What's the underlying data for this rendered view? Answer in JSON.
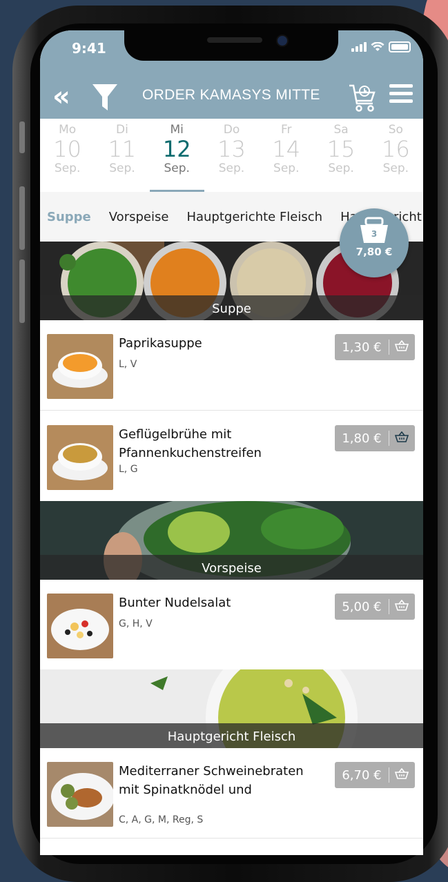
{
  "status": {
    "time": "9:41"
  },
  "header": {
    "title": "ORDER KAMASYS MITTE"
  },
  "days": [
    {
      "name": "Mo",
      "date": "10",
      "month": "Sep."
    },
    {
      "name": "Di",
      "date": "11",
      "month": "Sep."
    },
    {
      "name": "Mi",
      "date": "12",
      "month": "Sep."
    },
    {
      "name": "Do",
      "date": "13",
      "month": "Sep."
    },
    {
      "name": "Fr",
      "date": "14",
      "month": "Sep."
    },
    {
      "name": "Sa",
      "date": "15",
      "month": "Sep."
    },
    {
      "name": "So",
      "date": "16",
      "month": "Sep."
    }
  ],
  "categories": [
    "Suppe",
    "Vorspeise",
    "Hauptgerichte Fleisch",
    "Hauptgericht"
  ],
  "basket": {
    "count": "3",
    "total": "7,80 €"
  },
  "sections": [
    {
      "label": "Suppe"
    },
    {
      "label": "Vorspeise"
    },
    {
      "label": "Hauptgericht Fleisch"
    }
  ],
  "items": [
    {
      "name": "Paprikasuppe",
      "allergens": "L, V",
      "price": "1,30 €"
    },
    {
      "name": "Geflügelbrühe mit Pfannenkuchenstreifen",
      "allergens": "L, G",
      "price": "1,80 €"
    },
    {
      "name": "Bunter Nudelsalat",
      "allergens": "G, H, V",
      "price": "5,00 €"
    },
    {
      "name": "Mediterraner Schweinebraten mit Spinatknödel und",
      "allergens": "C, A, G, M, Reg, S",
      "price": "6,70 €"
    }
  ],
  "colors": {
    "header": "#8aa8b8",
    "active_day": "#0d6b6e",
    "price_button": "#aeaeae"
  }
}
